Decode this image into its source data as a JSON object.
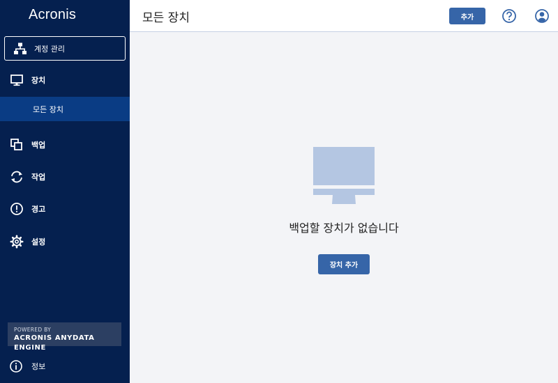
{
  "sidebar": {
    "logo": "Acronis",
    "account_button": {
      "label": "계정 관리",
      "icon": "hierarchy-icon"
    },
    "items": [
      {
        "label": "장치",
        "icon": "monitor-icon"
      },
      {
        "label": "모든 장치",
        "selected": true
      },
      {
        "label": "백업",
        "icon": "copy-icon"
      },
      {
        "label": "작업",
        "icon": "sync-icon"
      },
      {
        "label": "경고",
        "icon": "alert-icon"
      },
      {
        "label": "설정",
        "icon": "gear-icon"
      }
    ],
    "powered_by": {
      "line1": "POWERED BY",
      "line2": "ACRONIS ANYDATA ENGINE"
    },
    "info": {
      "label": "정보",
      "icon": "info-icon"
    }
  },
  "header": {
    "title": "모든 장치",
    "add_button": "추가",
    "help_icon": "help-icon",
    "user_icon": "user-icon"
  },
  "main": {
    "empty_message": "백업할 장치가 없습니다",
    "add_device_button": "장치 추가"
  },
  "colors": {
    "sidebar_bg": "#05204f",
    "sidebar_selected": "#0a3c84",
    "accent_button": "#3665a8",
    "illustration": "#b4c6e2",
    "main_bg": "#f3f4f7"
  }
}
